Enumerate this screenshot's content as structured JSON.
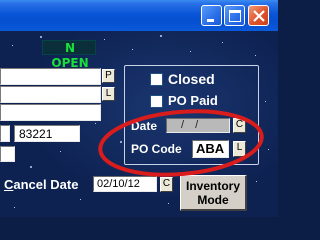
{
  "window": {
    "buttons": [
      "minimize-icon",
      "maximize-icon",
      "close-icon"
    ]
  },
  "status": {
    "text": "N OPEN",
    "color": "#19e039"
  },
  "left_fields": {
    "p_button": "P",
    "l_button": "L",
    "number_value": "83221"
  },
  "group": {
    "closed_label": "Closed",
    "closed_checked": false,
    "po_paid_label": "PO Paid",
    "po_paid_checked": false,
    "date_label": "Date",
    "date_value": "/ /",
    "date_button": "C",
    "po_code_label": "PO Code",
    "po_code_value": "ABA",
    "po_code_button": "L"
  },
  "cancel": {
    "label": "Cancel Date",
    "accel_letter": "C",
    "rest_label": "ancel Date",
    "value": "02/10/12",
    "button": "C"
  },
  "inventory_button": {
    "line1": "Inventory",
    "line2": "Mode"
  },
  "colors": {
    "titlebar": "#0a55d8",
    "background": "#0e2252",
    "highlight_ellipse": "#d91c1c"
  }
}
